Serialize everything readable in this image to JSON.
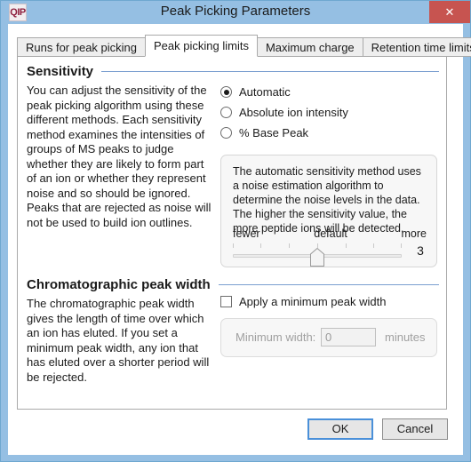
{
  "window": {
    "title": "Peak Picking Parameters",
    "app_icon": "QIP",
    "close_icon": "close-icon",
    "close_label": "✕",
    "titlebar_color": "#95bfe3",
    "close_button_color": "#c75450"
  },
  "tabs": [
    {
      "label": "Runs for peak picking",
      "active": false
    },
    {
      "label": "Peak picking limits",
      "active": true
    },
    {
      "label": "Maximum charge",
      "active": false
    },
    {
      "label": "Retention time limits",
      "active": false
    }
  ],
  "sensitivity": {
    "heading": "Sensitivity",
    "description": "You can adjust the sensitivity of the peak picking algorithm using these different methods. Each sensitivity method examines the intensities of groups of MS peaks to judge whether they are likely to form part of an ion or whether they represent noise and so should be ignored. Peaks that are rejected as noise will not be used to build ion outlines.",
    "options": [
      {
        "label": "Automatic",
        "selected": true
      },
      {
        "label": "Absolute ion intensity",
        "selected": false
      },
      {
        "label": "% Base Peak",
        "selected": false
      }
    ],
    "info": {
      "text": "The automatic sensitivity method uses a noise estimation algorithm to determine the noise levels in the data. The higher the sensitivity value, the more peptide ions will be detected.",
      "slider_min_label": "fewer",
      "slider_mid_label": "default",
      "slider_max_label": "more",
      "slider_value": "3"
    }
  },
  "chromatographic_peak_width": {
    "heading": "Chromatographic peak width",
    "description": "The chromatographic peak width gives the length of time over which an ion has eluted. If you set a minimum peak width, any ion that has eluted over a shorter period will be rejected.",
    "apply_checkbox_label": "Apply a minimum peak width",
    "apply_checked": false,
    "min_width_label": "Minimum width:",
    "min_width_value": "0",
    "min_width_units": "minutes"
  },
  "footer": {
    "ok_label": "OK",
    "cancel_label": "Cancel"
  },
  "accent_color": "#4a90d9",
  "rule_color": "#7b9fd0"
}
